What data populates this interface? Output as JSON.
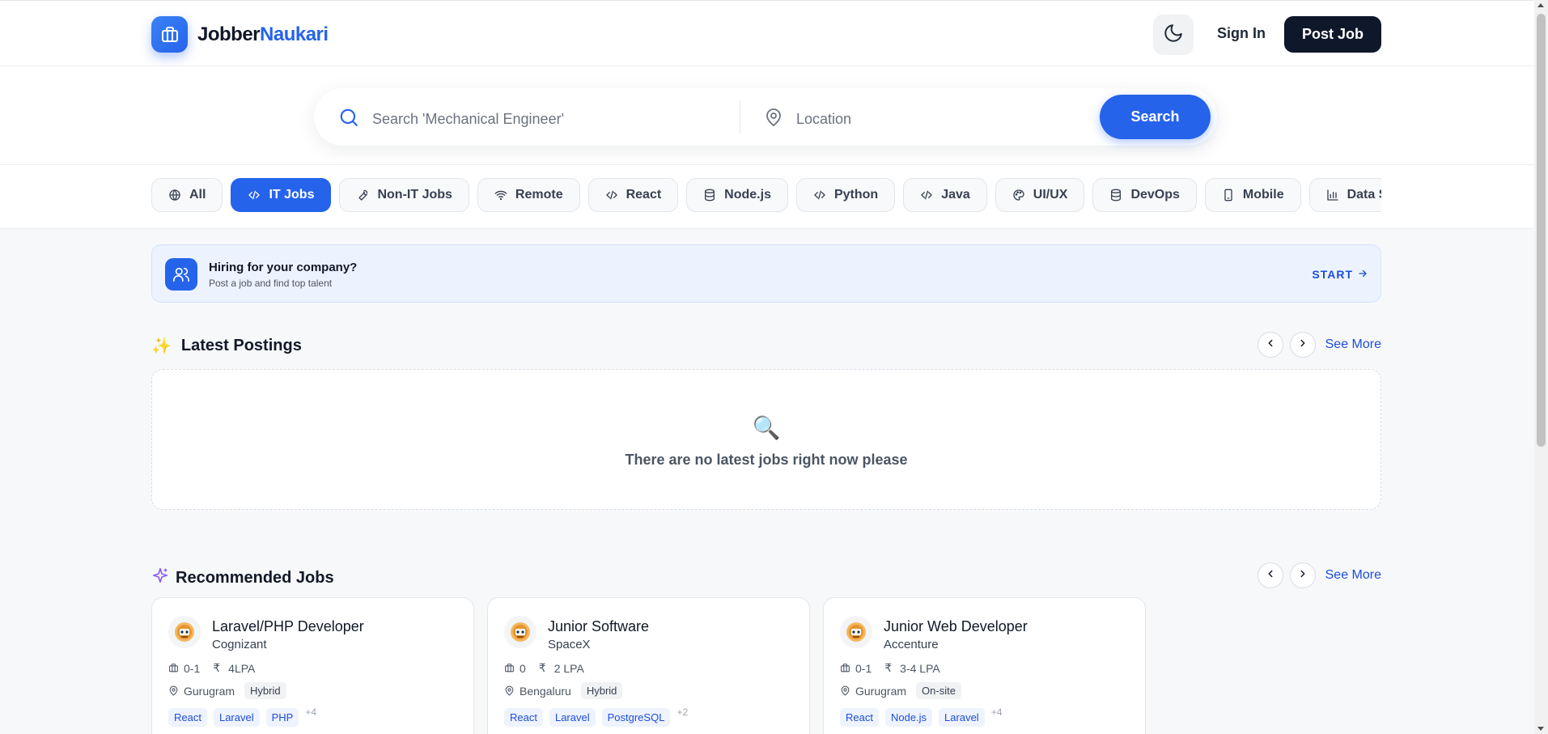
{
  "header": {
    "logo_part1": "Jobber",
    "logo_part2": "Naukari",
    "signin_label": "Sign In",
    "postjob_label": "Post Job"
  },
  "search": {
    "query_placeholder": "Search 'Mechanical Engineer'",
    "location_placeholder": "Location",
    "button_label": "Search"
  },
  "categories": [
    {
      "label": "All",
      "icon": "globe-icon",
      "active": false
    },
    {
      "label": "IT Jobs",
      "icon": "code-icon",
      "active": true
    },
    {
      "label": "Non-IT Jobs",
      "icon": "wrench-icon",
      "active": false
    },
    {
      "label": "Remote",
      "icon": "wifi-icon",
      "active": false
    },
    {
      "label": "React",
      "icon": "code-icon",
      "active": false
    },
    {
      "label": "Node.js",
      "icon": "database-icon",
      "active": false
    },
    {
      "label": "Python",
      "icon": "code-icon",
      "active": false
    },
    {
      "label": "Java",
      "icon": "code-icon",
      "active": false
    },
    {
      "label": "UI/UX",
      "icon": "palette-icon",
      "active": false
    },
    {
      "label": "DevOps",
      "icon": "database-icon",
      "active": false
    },
    {
      "label": "Mobile",
      "icon": "smartphone-icon",
      "active": false
    },
    {
      "label": "Data Science",
      "icon": "bar-chart-icon",
      "active": false
    }
  ],
  "hiring": {
    "title": "Hiring for your company?",
    "subtitle": "Post a job and find top talent",
    "cta": "START"
  },
  "latest": {
    "title": "Latest Postings",
    "see_more": "See More",
    "empty_icon": "🔍",
    "empty_text": "There are no latest jobs right now please"
  },
  "recommended": {
    "title": "Recommended Jobs",
    "see_more": "See More",
    "jobs": [
      {
        "title": "Laravel/PHP Developer",
        "company": "Cognizant",
        "experience": "0-1",
        "salary": "4LPA",
        "location": "Gurugram",
        "mode": "Hybrid",
        "skills": [
          "React",
          "Laravel",
          "PHP"
        ],
        "more": "+4"
      },
      {
        "title": "Junior Software",
        "company": "SpaceX",
        "experience": "0",
        "salary": "2 LPA",
        "location": "Bengaluru",
        "mode": "Hybrid",
        "skills": [
          "React",
          "Laravel",
          "PostgreSQL"
        ],
        "more": "+2"
      },
      {
        "title": "Junior Web Developer",
        "company": "Accenture",
        "experience": "0-1",
        "salary": "3-4 LPA",
        "location": "Gurugram",
        "mode": "On-site",
        "skills": [
          "React",
          "Node.js",
          "Laravel"
        ],
        "more": "+4"
      }
    ]
  },
  "colors": {
    "brand": "#2563eb",
    "dark": "#0f172a",
    "accent_sparkle": "#8b5cf6"
  }
}
